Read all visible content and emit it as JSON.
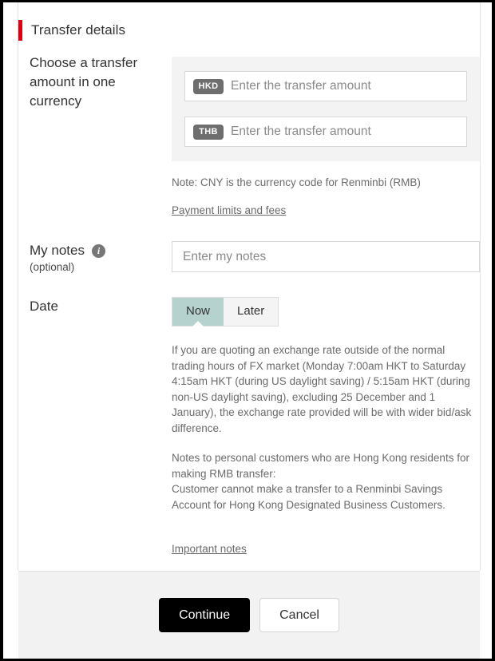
{
  "section": {
    "title": "Transfer details",
    "accent_color": "#db0011"
  },
  "amount": {
    "label": "Choose a transfer amount in one currency",
    "fields": [
      {
        "currency": "HKD",
        "value": "",
        "placeholder": "Enter the transfer amount"
      },
      {
        "currency": "THB",
        "value": "",
        "placeholder": "Enter the transfer amount"
      }
    ],
    "note": "Note: CNY is the currency code for Renminbi (RMB)",
    "link": "Payment limits and fees"
  },
  "notes": {
    "label": "My notes",
    "sub_label": "(optional)",
    "info_icon": "info-icon",
    "value": "",
    "placeholder": "Enter my notes"
  },
  "date": {
    "label": "Date",
    "options": [
      {
        "label": "Now",
        "selected": true
      },
      {
        "label": "Later",
        "selected": false
      }
    ],
    "selected_color": "#b6d2ce"
  },
  "disclaimers": {
    "fx_hours": "If you are quoting an exchange rate outside of the normal trading hours of FX market (Monday 7:00am HKT to Saturday 4:15am HKT (during US daylight saving) / 5:15am HKT (during non-US daylight saving), excluding 25 December and 1 January), the exchange rate provided will be with wider bid/ask difference.",
    "rmb_notes_line1": "Notes to personal customers who are Hong Kong residents for making RMB transfer:",
    "rmb_notes_line2": "Customer cannot make a transfer to a Renminbi Savings Account for Hong Kong Designated Business Customers.",
    "important_link": "Important notes"
  },
  "footer": {
    "continue_label": "Continue",
    "cancel_label": "Cancel"
  }
}
